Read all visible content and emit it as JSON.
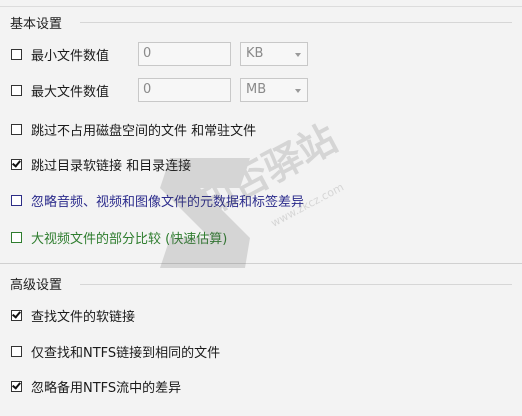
{
  "basic": {
    "title": "基本设置",
    "min_file": {
      "label": "最小文件数值",
      "value": "0",
      "unit": "KB"
    },
    "max_file": {
      "label": "最大文件数值",
      "value": "0",
      "unit": "MB"
    },
    "skip_sparse": "跳过不占用磁盘空间的文件 和常驻文件",
    "skip_links": "跳过目录软链接 和目录连接",
    "ignore_meta": "忽略音频、视频和图像文件的元数据和标签差异",
    "partial_compare": "大视频文件的部分比较 (快速估算)"
  },
  "advanced": {
    "title": "高级设置",
    "find_symlinks": "查找文件的软链接",
    "ntfs_same": "仅查找和NTFS链接到相同的文件",
    "ignore_streams": "忽略备用NTFS流中的差异"
  },
  "watermark": {
    "text": "知否驿站",
    "url": "www.zkcz.com"
  }
}
